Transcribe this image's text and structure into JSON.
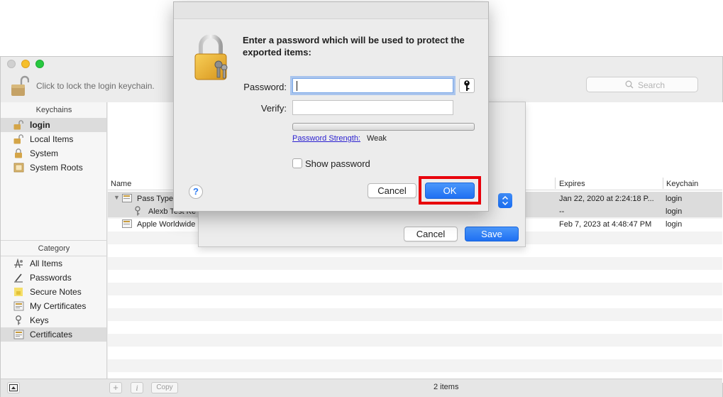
{
  "window": {
    "lock_label": "Click to lock the login keychain.",
    "search_placeholder": "Search"
  },
  "sidebar": {
    "keychains_header": "Keychains",
    "keychains": [
      {
        "label": "login",
        "icon": "unlocked-padlock-icon",
        "selected": true
      },
      {
        "label": "Local Items",
        "icon": "unlocked-padlock-icon"
      },
      {
        "label": "System",
        "icon": "locked-padlock-icon"
      },
      {
        "label": "System Roots",
        "icon": "cabinet-icon"
      }
    ],
    "category_header": "Category",
    "categories": [
      {
        "label": "All Items",
        "icon": "all-items-icon"
      },
      {
        "label": "Passwords",
        "icon": "pen-icon"
      },
      {
        "label": "Secure Notes",
        "icon": "note-icon"
      },
      {
        "label": "My Certificates",
        "icon": "certificate-icon"
      },
      {
        "label": "Keys",
        "icon": "key-icon"
      },
      {
        "label": "Certificates",
        "icon": "certificate-icon",
        "selected": true
      }
    ]
  },
  "table": {
    "columns": [
      "Name",
      "Expires",
      "Keychain"
    ],
    "rows": [
      {
        "name": "Pass Type",
        "expires": "Jan 22, 2020 at 2:24:18 P...",
        "keychain": "login"
      },
      {
        "name": "Alexb Test Ke",
        "expires": "--",
        "keychain": "login"
      },
      {
        "name": "Apple Worldwide",
        "expires": "Feb 7, 2023 at 4:48:47 PM",
        "keychain": "login"
      }
    ]
  },
  "status_bar": {
    "add_label": "+",
    "info_label": "i",
    "copy_label": "Copy",
    "count": "2 items"
  },
  "sheet": {
    "cancel_label": "Cancel",
    "save_label": "Save"
  },
  "dialog": {
    "message": "Enter a password which will be used to protect the exported items:",
    "password_label": "Password:",
    "password_value": "",
    "verify_label": "Verify:",
    "verify_value": "",
    "strength_link": "Password Strength:",
    "strength_value": "Weak",
    "show_password_label": "Show password",
    "show_password_checked": false,
    "help_label": "?",
    "cancel_label": "Cancel",
    "ok_label": "OK"
  },
  "colors": {
    "accent_blue": "#1f70f2",
    "highlight_red": "#e8000b",
    "link_blue": "#2a1fd0"
  }
}
